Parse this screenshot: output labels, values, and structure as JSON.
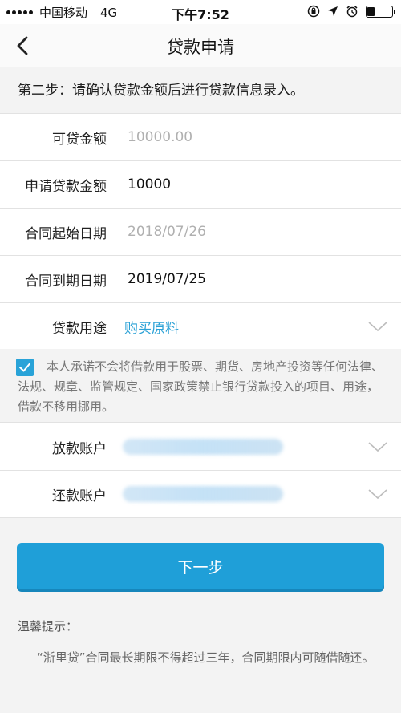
{
  "status_bar": {
    "carrier": "中国移动",
    "network": "4G",
    "time": "下午7:52"
  },
  "nav": {
    "title": "贷款申请"
  },
  "step_hint": "第二步：请确认贷款金额后进行贷款信息录入。",
  "form": {
    "available_amount": {
      "label": "可贷金额",
      "value": "10000.00"
    },
    "apply_amount": {
      "label": "申请贷款金额",
      "value": "10000"
    },
    "start_date": {
      "label": "合同起始日期",
      "value": "2018/07/26"
    },
    "end_date": {
      "label": "合同到期日期",
      "value": "2019/07/25"
    },
    "purpose": {
      "label": "贷款用途",
      "value": "购买原料"
    }
  },
  "agreement": {
    "checked": true,
    "text": "本人承诺不会将借款用于股票、期货、房地产投资等任何法律、法规、规章、监管规定、国家政策禁止银行贷款投入的项目、用途，借款不移用挪用。"
  },
  "accounts": {
    "disburse": {
      "label": "放款账户"
    },
    "repay": {
      "label": "还款账户"
    }
  },
  "next_button": "下一步",
  "tip": {
    "title": "温馨提示：",
    "text": "“浙里贷”合同最长期限不得超过三年，合同期限内可随借随还。"
  },
  "colors": {
    "accent": "#1f9fd8",
    "link": "#2aa1d6",
    "muted": "#b0b0b0"
  }
}
